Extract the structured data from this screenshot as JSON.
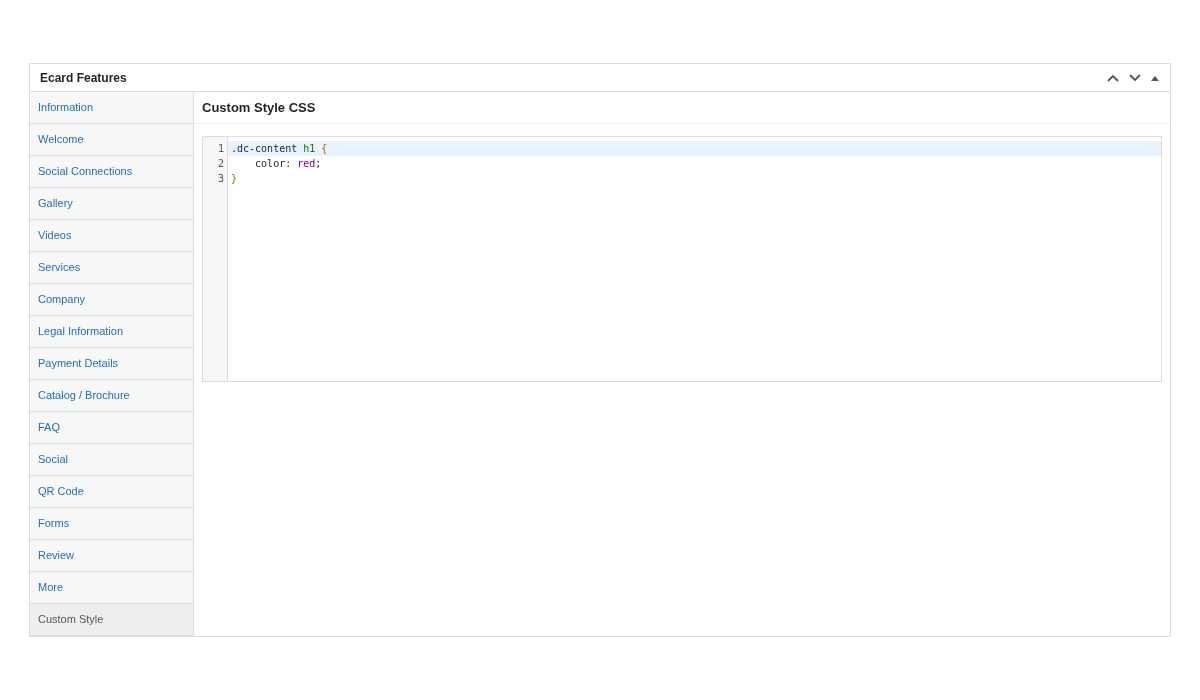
{
  "panel": {
    "title": "Ecard Features"
  },
  "sidebar": {
    "items": [
      {
        "label": "Information",
        "selected": false
      },
      {
        "label": "Welcome",
        "selected": false
      },
      {
        "label": "Social Connections",
        "selected": false
      },
      {
        "label": "Gallery",
        "selected": false
      },
      {
        "label": "Videos",
        "selected": false
      },
      {
        "label": "Services",
        "selected": false
      },
      {
        "label": "Company",
        "selected": false
      },
      {
        "label": "Legal Information",
        "selected": false
      },
      {
        "label": "Payment Details",
        "selected": false
      },
      {
        "label": "Catalog / Brochure",
        "selected": false
      },
      {
        "label": "FAQ",
        "selected": false
      },
      {
        "label": "Social",
        "selected": false
      },
      {
        "label": "QR Code",
        "selected": false
      },
      {
        "label": "Forms",
        "selected": false
      },
      {
        "label": "Review",
        "selected": false
      },
      {
        "label": "More",
        "selected": false
      },
      {
        "label": "Custom Style",
        "selected": true
      }
    ]
  },
  "content": {
    "title": "Custom Style CSS",
    "editor": {
      "lines": [
        {
          "number": "1",
          "active": true,
          "tokens": [
            {
              "kind": "plain",
              "text": ".dc-content "
            },
            {
              "kind": "tag",
              "text": "h1"
            },
            {
              "kind": "bracket",
              "text": " {"
            }
          ]
        },
        {
          "number": "2",
          "active": false,
          "tokens": [
            {
              "kind": "plain",
              "text": "    color: "
            },
            {
              "kind": "keyword",
              "text": "red"
            },
            {
              "kind": "plain",
              "text": ";"
            }
          ]
        },
        {
          "number": "3",
          "active": false,
          "tokens": [
            {
              "kind": "bracket",
              "text": "}"
            }
          ]
        }
      ]
    }
  }
}
